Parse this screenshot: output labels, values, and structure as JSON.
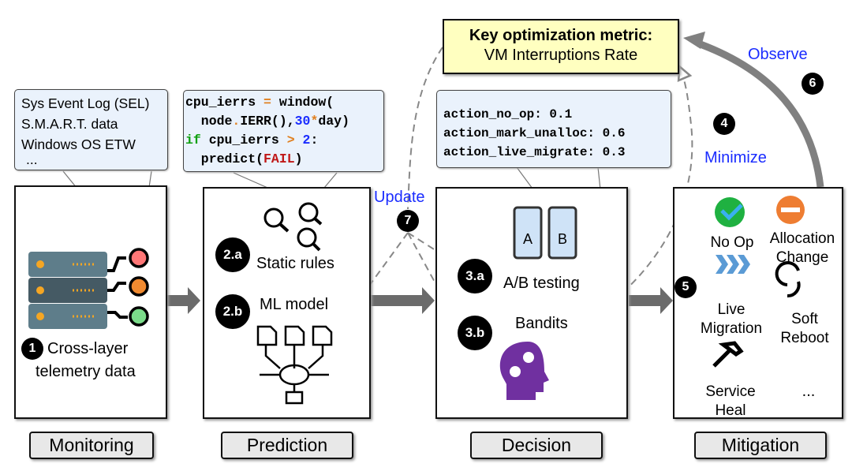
{
  "metric": {
    "title": "Key optimization metric:",
    "subtitle": "VM Interruptions Rate"
  },
  "telemetry_sources": [
    "Sys Event Log (SEL)",
    "S.M.A.R.T. data",
    "Windows OS ETW",
    "..."
  ],
  "code": {
    "l1a": "cpu_ierrs ",
    "l1op": "=",
    "l1b": " window(",
    "l2a": "  node",
    "l2dot": ".",
    "l2b": "IERR(),",
    "l2num": "30",
    "l2star": "*",
    "l2c": "day)",
    "l3kw": "if",
    "l3a": " cpu_ierrs ",
    "l3op": ">",
    "l3num": " 2",
    "l3b": ":",
    "l4a": "  predict(",
    "l4fail": "FAIL",
    "l4b": ")"
  },
  "actions": [
    "action_no_op: 0.1",
    "action_mark_unalloc: 0.6",
    "action_live_migrate: 0.3"
  ],
  "monitoring": {
    "step": "1",
    "label_line1": "Cross-layer",
    "label_line2": "telemetry data",
    "stage": "Monitoring"
  },
  "prediction": {
    "static_step": "2.a",
    "static_label": "Static rules",
    "ml_step": "2.b",
    "ml_label": "ML model",
    "stage": "Prediction"
  },
  "decision": {
    "ab_step": "3.a",
    "ab_label": "A/B testing",
    "bandit_step": "3.b",
    "bandit_label": "Bandits",
    "stage": "Decision"
  },
  "mitigation": {
    "step": "5",
    "stage": "Mitigation",
    "actions": [
      {
        "label": "No Op",
        "icon": "check-circle-icon"
      },
      {
        "label": "Allocation Change",
        "icon": "minus-circle-icon"
      },
      {
        "label": "Live Migration",
        "icon": "chevrons-right-icon"
      },
      {
        "label": "Soft Reboot",
        "icon": "refresh-icon"
      },
      {
        "label": "Service Heal",
        "icon": "hammer-icon"
      },
      {
        "label": "...",
        "icon": ""
      }
    ]
  },
  "loop": {
    "observe": "Observe",
    "observe_step": "6",
    "minimize": "Minimize",
    "minimize_step": "4",
    "update": "Update",
    "update_step": "7"
  },
  "colors": {
    "metric_bg": "#ffffc0",
    "note_bg": "#eaf2fc",
    "loop_text": "#1a2cff",
    "arrow": "#6b6b6b",
    "brace": "#8b0f0f"
  }
}
